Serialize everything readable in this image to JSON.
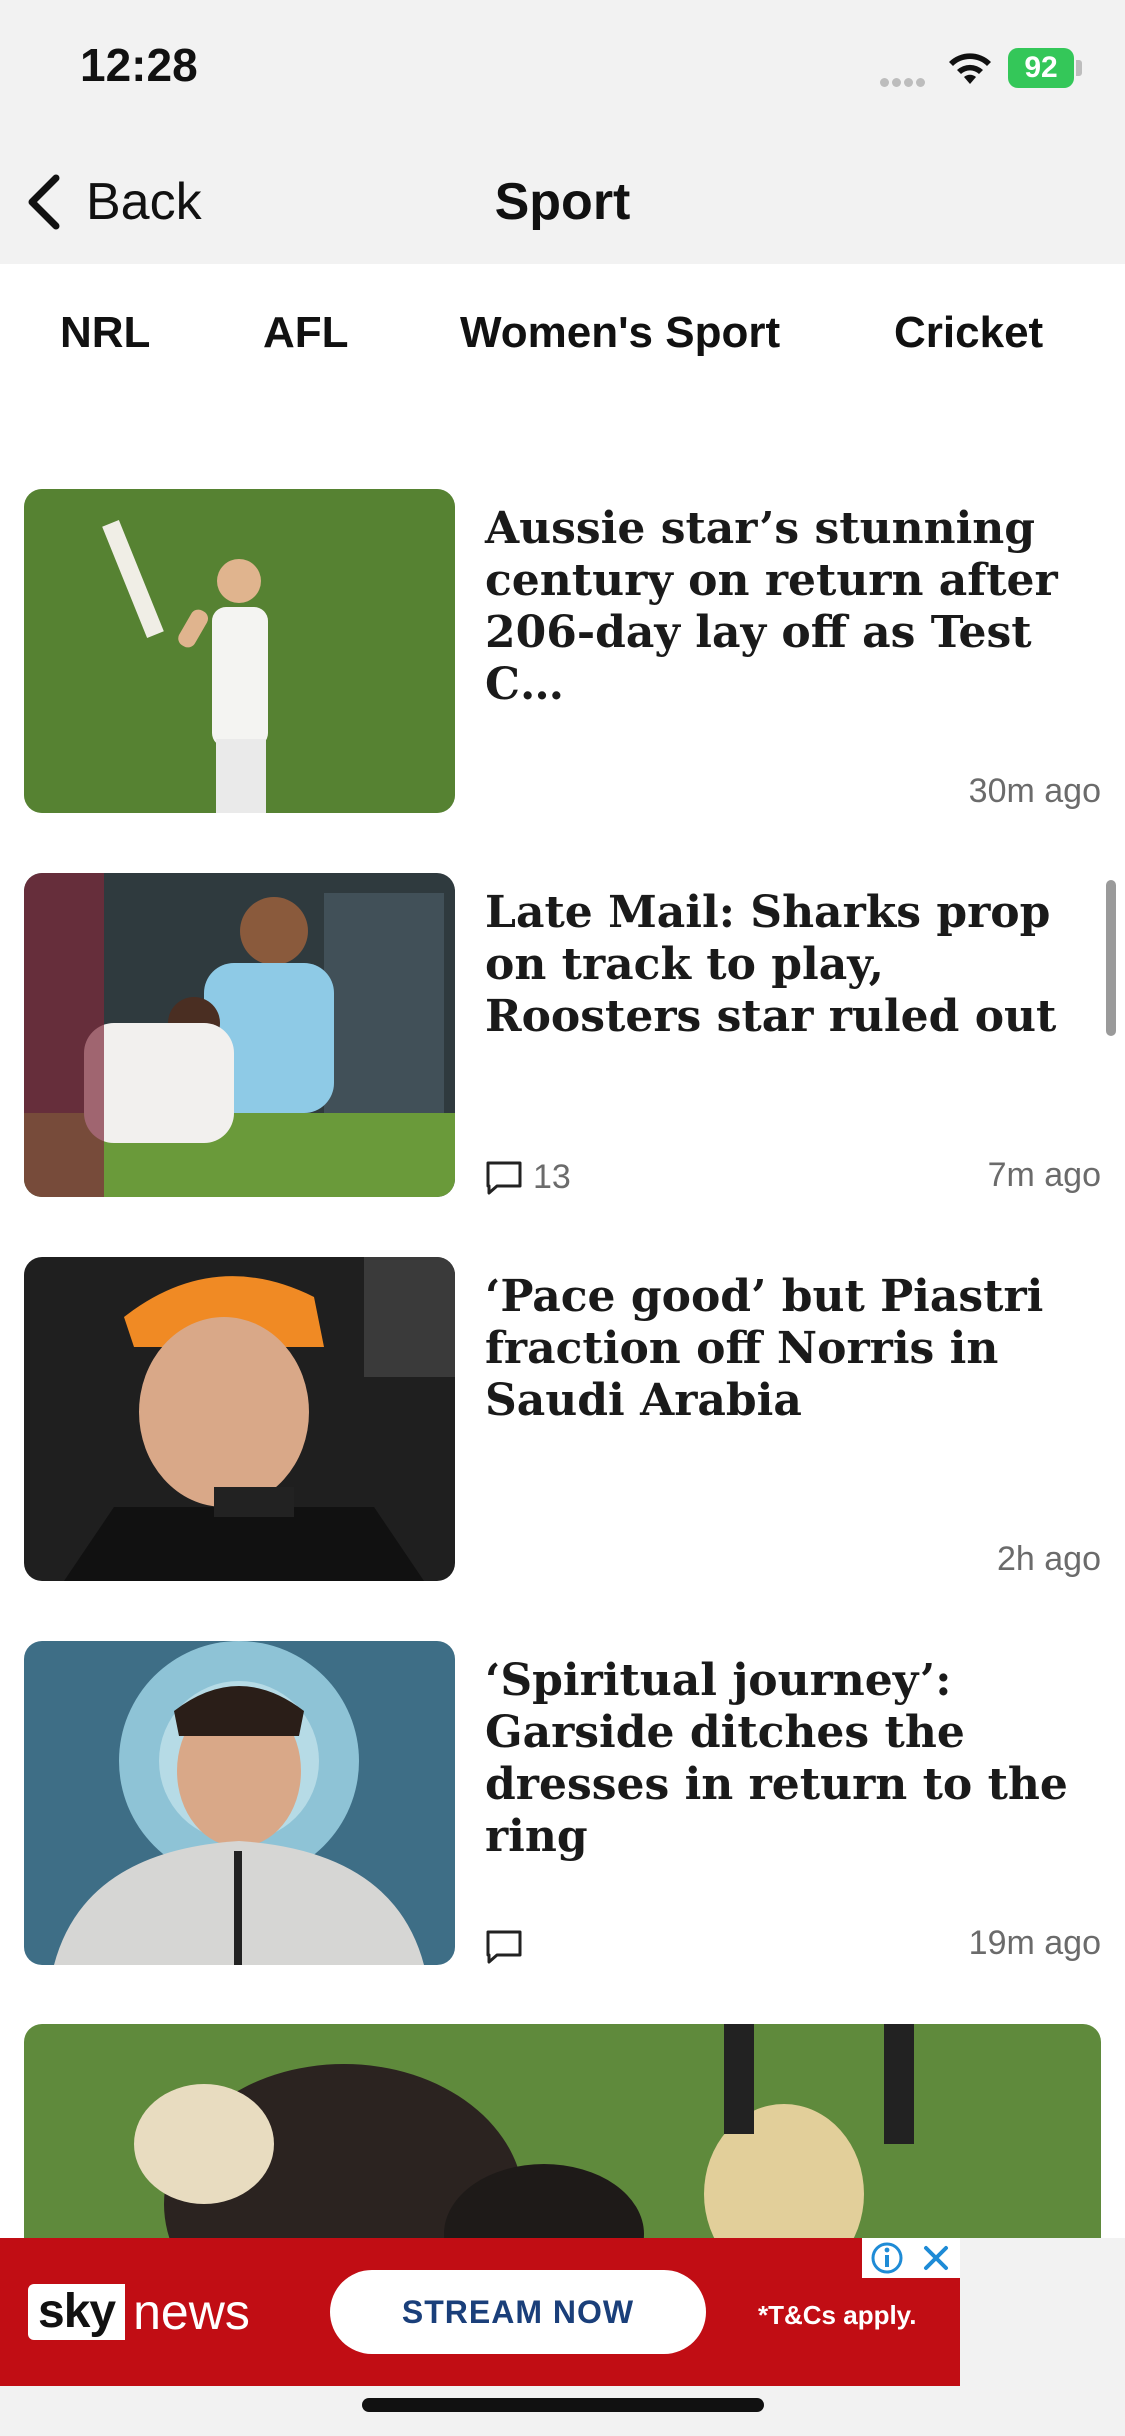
{
  "status": {
    "time": "12:28",
    "battery": "92"
  },
  "nav": {
    "back_label": "Back",
    "title": "Sport"
  },
  "tabs": [
    "NRL",
    "AFL",
    "Women's Sport",
    "Cricket"
  ],
  "articles": [
    {
      "headline": "Aussie star’s stunning century on return after 206-day lay off as Test C…",
      "time": "30m  ago",
      "comments": ""
    },
    {
      "headline": "Late Mail: Sharks prop on track to play, Roosters star ruled out",
      "time": "7m  ago",
      "comments": "13"
    },
    {
      "headline": "‘Pace good’ but Piastri fraction off Norris in Saudi Arabia",
      "time": "2h  ago",
      "comments": ""
    },
    {
      "headline": "‘Spiritual journey’: Garside ditches the dresses in return to the ring",
      "time": "19m  ago",
      "comments": ""
    }
  ],
  "ad": {
    "brand_sky": "sky",
    "brand_news": "news",
    "cta": "STREAM NOW",
    "terms": "*T&Cs apply."
  },
  "colors": {
    "ad_red": "#c10d14",
    "battery_green": "#34c759",
    "cta_blue": "#1a3f7a"
  }
}
